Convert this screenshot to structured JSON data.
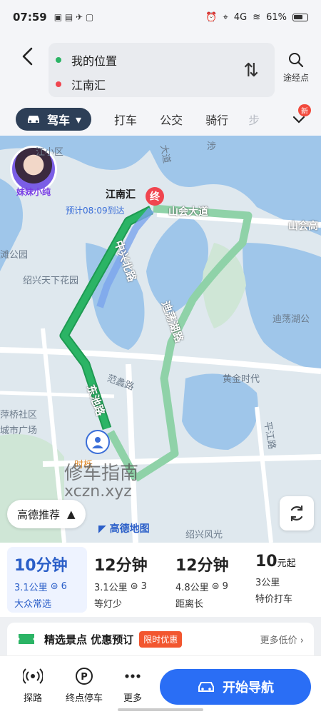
{
  "status_bar": {
    "time": "07:59",
    "battery": "61%",
    "network": "4G"
  },
  "header": {
    "origin": "我的位置",
    "destination": "江南汇",
    "waypoint_label": "途经点"
  },
  "tabs": {
    "active": "驾车",
    "items": [
      "打车",
      "公交",
      "骑行",
      "步"
    ],
    "new_badge": "新"
  },
  "map": {
    "destination_name": "江南汇",
    "destination_pin": "终",
    "eta": "预计08:09到达",
    "avatar_caption": "妹妹小纯",
    "road_labels": [
      "中兴北路",
      "迪荡湖路",
      "东池路",
      "山会大道",
      "山会高",
      "平江路"
    ],
    "place_labels": [
      "江小区",
      "涉",
      "滩公园",
      "绍兴天下花园",
      "迪荡湖公",
      "黄金时代",
      "萍桥社区",
      "城市广场",
      "时栎",
      "范蠡路",
      "大道",
      "绍兴风光"
    ],
    "watermark_line1": "修车指南",
    "watermark_line2": "xczn.xyz",
    "recommend_label": "高德推荐",
    "map_logo": "高德地图"
  },
  "routes": [
    {
      "time": "10分钟",
      "distance": "3.1公里",
      "lights": "6",
      "note": "大众常选",
      "selected": true
    },
    {
      "time": "12分钟",
      "distance": "3.1公里",
      "lights": "3",
      "note": "等灯少",
      "selected": false
    },
    {
      "time": "12分钟",
      "distance": "4.8公里",
      "lights": "9",
      "note": "距离长",
      "selected": false
    },
    {
      "time": "10",
      "time_unit": "元起",
      "distance": "3公里",
      "note": "特价打车",
      "selected": false
    }
  ],
  "promo": {
    "title": "精选景点 优惠预订",
    "badge": "限时优惠",
    "more": "更多低价 ›"
  },
  "bottom": {
    "items": [
      "探路",
      "终点停车",
      "更多"
    ],
    "start_nav": "开始导航"
  },
  "colors": {
    "accent": "#2a6ef5",
    "route_main": "#2bb465",
    "route_alt": "#8fd2a8",
    "dest": "#f0454f"
  }
}
